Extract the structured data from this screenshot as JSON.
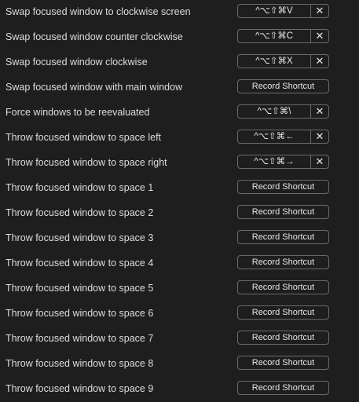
{
  "shortcuts": [
    {
      "label": "Swap focused window to clockwise screen",
      "shortcut": "^⌥⇧⌘V"
    },
    {
      "label": "Swap focused window counter clockwise",
      "shortcut": "^⌥⇧⌘C"
    },
    {
      "label": "Swap focused window clockwise",
      "shortcut": "^⌥⇧⌘X"
    },
    {
      "label": "Swap focused window with main window",
      "shortcut": null
    },
    {
      "label": "Force windows to be reevaluated",
      "shortcut": "^⌥⇧⌘\\"
    },
    {
      "label": "Throw focused window to space left",
      "shortcut": "^⌥⇧⌘←"
    },
    {
      "label": "Throw focused window to space right",
      "shortcut": "^⌥⇧⌘→"
    },
    {
      "label": "Throw focused window to space 1",
      "shortcut": null
    },
    {
      "label": "Throw focused window to space 2",
      "shortcut": null
    },
    {
      "label": "Throw focused window to space 3",
      "shortcut": null
    },
    {
      "label": "Throw focused window to space 4",
      "shortcut": null
    },
    {
      "label": "Throw focused window to space 5",
      "shortcut": null
    },
    {
      "label": "Throw focused window to space 6",
      "shortcut": null
    },
    {
      "label": "Throw focused window to space 7",
      "shortcut": null
    },
    {
      "label": "Throw focused window to space 8",
      "shortcut": null
    },
    {
      "label": "Throw focused window to space 9",
      "shortcut": null
    }
  ],
  "record_label": "Record Shortcut",
  "clear_icon": "✕"
}
